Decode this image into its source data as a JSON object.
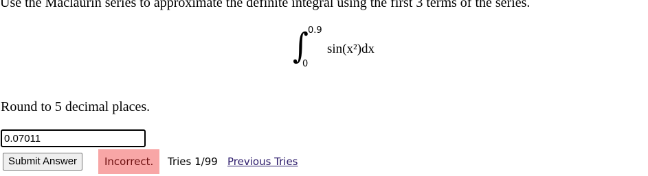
{
  "question": {
    "text": "Use the Maclaurin series to approximate the definite integral using the first 3 terms of the series."
  },
  "integral": {
    "sign": "∫",
    "upper_limit": "0.9",
    "lower_limit": "0",
    "integrand": "sin(x²)dx"
  },
  "instruction": "Round to 5 decimal places.",
  "answer": {
    "value": "0.07011"
  },
  "submit_label": "Submit Answer",
  "status": {
    "label": "Incorrect.",
    "color": "#f8a6a6"
  },
  "tries": {
    "text": "Tries 1/99"
  },
  "previous_tries_label": "Previous Tries"
}
